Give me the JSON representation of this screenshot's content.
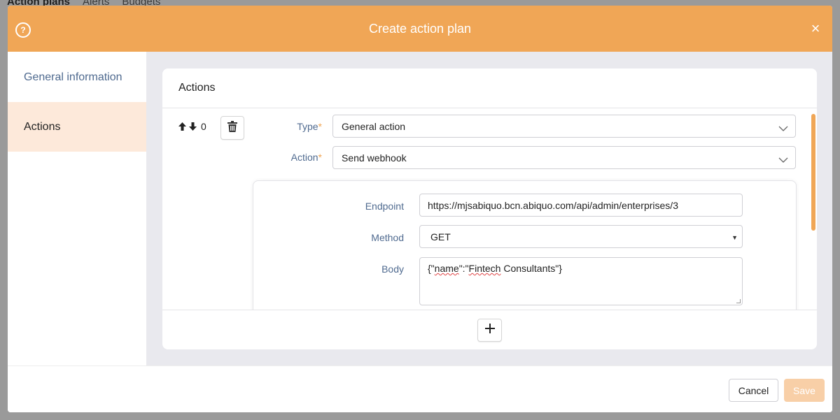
{
  "backdrop": {
    "tabs": [
      "Action plans",
      "Alerts",
      "Budgets"
    ]
  },
  "modal": {
    "title": "Create action plan",
    "help_label": "?",
    "close_label": "×"
  },
  "sidenav": {
    "items": [
      {
        "label": "General information",
        "active": false
      },
      {
        "label": "Actions",
        "active": true
      }
    ]
  },
  "actions_panel": {
    "title": "Actions",
    "index": "0",
    "type": {
      "label": "Type",
      "required_mark": "*",
      "value": "General action"
    },
    "action": {
      "label": "Action",
      "required_mark": "*",
      "value": "Send webhook"
    },
    "webhook": {
      "endpoint": {
        "label": "Endpoint",
        "value": "https://mjsabiquo.bcn.abiquo.com/api/admin/enterprises/3"
      },
      "method": {
        "label": "Method",
        "value": "GET"
      },
      "body": {
        "label": "Body",
        "prefix": "{\"",
        "key": "name",
        "middle": "\":\"",
        "misspelled": "Fintech",
        "suffix": " Consultants\"}"
      }
    },
    "add_label": "+"
  },
  "footer": {
    "cancel_label": "Cancel",
    "save_label": "Save"
  },
  "colors": {
    "accent": "#f0a656",
    "nav_active_bg": "#fde9da",
    "label_blue": "#4f6a8f",
    "save_disabled": "#f8cfa7"
  }
}
